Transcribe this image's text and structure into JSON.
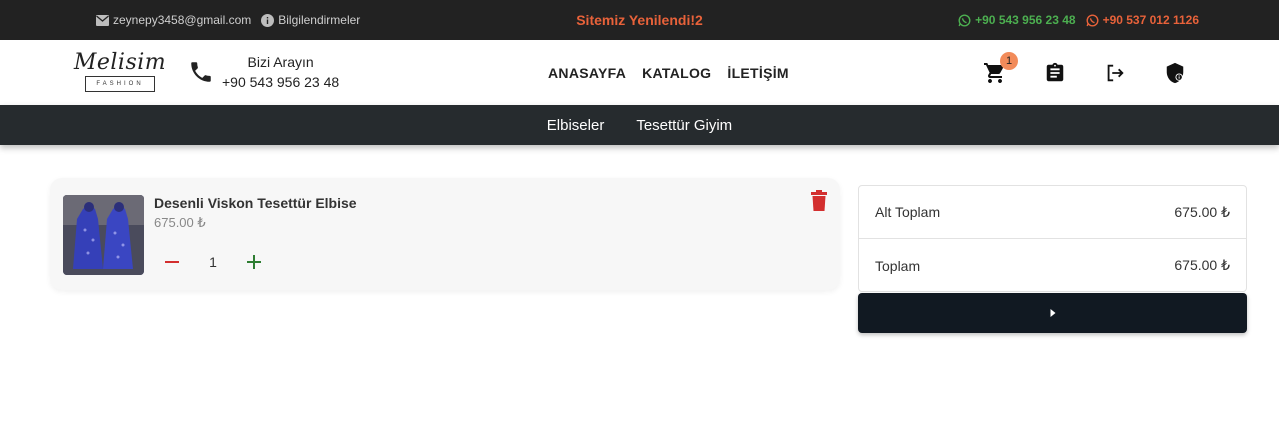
{
  "topbar": {
    "email": "zeynepy3458@gmail.com",
    "info_label": "Bilgilendirmeler",
    "announcement": "Sitemiz Yenilendi!2",
    "phone_1": "+90 543 956 23 48",
    "phone_2": "+90 537 012 1126",
    "phone_1_color": "#4caf50",
    "phone_2_color": "#e8623a"
  },
  "header": {
    "logo_text": "Melisim",
    "logo_subtext": "FASHION",
    "call_label": "Bizi Arayın",
    "call_number": "+90 543 956 23 48",
    "nav": [
      "ANASAYFA",
      "KATALOG",
      "İLETİŞİM"
    ],
    "cart_count": "1",
    "icons": [
      "cart-icon",
      "clipboard-icon",
      "logout-icon",
      "shield-icon"
    ]
  },
  "categories": [
    "Elbiseler",
    "Tesettür Giyim"
  ],
  "cart": {
    "items": [
      {
        "name": "Desenli Viskon Tesettür Elbise",
        "price": "675.00 ₺",
        "quantity": "1"
      }
    ]
  },
  "summary": {
    "subtotal_label": "Alt Toplam",
    "subtotal_value": "675.00 ₺",
    "total_label": "Toplam",
    "total_value": "675.00 ₺"
  },
  "colors": {
    "topbar_bg": "#222222",
    "category_bar_bg": "#262b2e",
    "checkout_bg": "#111922",
    "minus": "#d32f2f",
    "plus": "#2e7d32",
    "trash": "#d32f2f",
    "badge": "#f28b5a"
  }
}
